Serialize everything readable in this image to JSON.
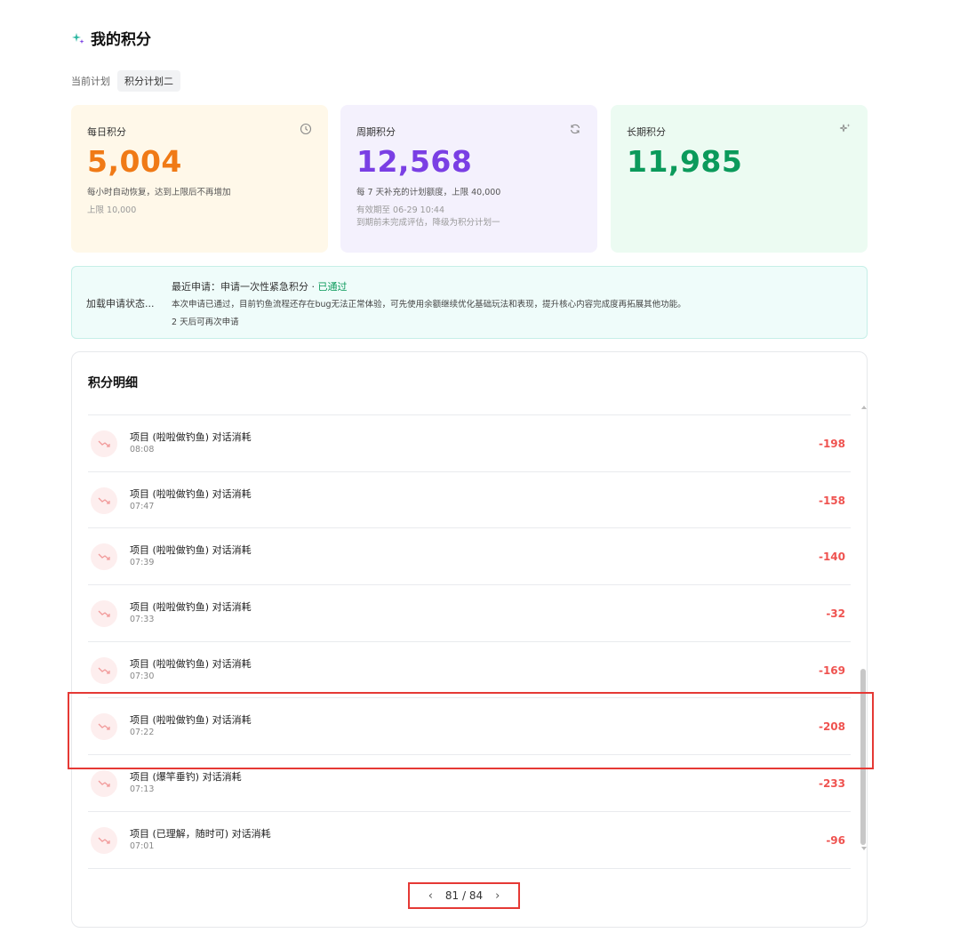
{
  "header": {
    "title": "我的积分",
    "icon": "sparkle-icon"
  },
  "plan": {
    "label": "当前计划",
    "value": "积分计划二"
  },
  "cards": {
    "daily": {
      "title": "每日积分",
      "icon": "clock-icon",
      "value": "5,004",
      "desc": "每小时自动恢复，达到上限后不再增加",
      "sub": "上限 10,000",
      "color": "#f07a16"
    },
    "period": {
      "title": "周期积分",
      "icon": "refresh-icon",
      "value": "12,568",
      "desc": "每 7 天补充的计划额度，上限 40,000",
      "sub1": "有效期至 06-29 10:44",
      "sub2": "到期前未完成评估，降级为积分计划一",
      "color": "#7a3fe4"
    },
    "long": {
      "title": "长期积分",
      "icon": "sparkle-icon",
      "value": "11,985",
      "color": "#0b9a5b"
    }
  },
  "status": {
    "loading": "加载申请状态...",
    "recent_label": "最近申请：申请一次性紧急积分 · ",
    "recent_status": "已通过",
    "message": "本次申请已通过，目前钓鱼流程还存在bug无法正常体验，可先使用余额继续优化基础玩法和表现，提升核心内容完成度再拓展其他功能。",
    "next": "2 天后可再次申请"
  },
  "detail": {
    "title": "积分明细",
    "rows": [
      {
        "name": "项目 (啦啦做钓鱼) 对话消耗",
        "time": "08:08",
        "amount": "-198"
      },
      {
        "name": "项目 (啦啦做钓鱼) 对话消耗",
        "time": "07:47",
        "amount": "-158"
      },
      {
        "name": "项目 (啦啦做钓鱼) 对话消耗",
        "time": "07:39",
        "amount": "-140"
      },
      {
        "name": "项目 (啦啦做钓鱼) 对话消耗",
        "time": "07:33",
        "amount": "-32"
      },
      {
        "name": "项目 (啦啦做钓鱼) 对话消耗",
        "time": "07:30",
        "amount": "-169"
      },
      {
        "name": "项目 (啦啦做钓鱼) 对话消耗",
        "time": "07:22",
        "amount": "-208"
      },
      {
        "name": "项目 (爆竿垂钓) 对话消耗",
        "time": "07:13",
        "amount": "-233"
      },
      {
        "name": "项目 (已理解，随时可) 对话消耗",
        "time": "07:01",
        "amount": "-96"
      }
    ],
    "row_icon": "trend-down-icon",
    "amount_color": "#ef5350"
  },
  "pagination": {
    "prev": "‹",
    "text": "81 / 84",
    "next": "›"
  }
}
